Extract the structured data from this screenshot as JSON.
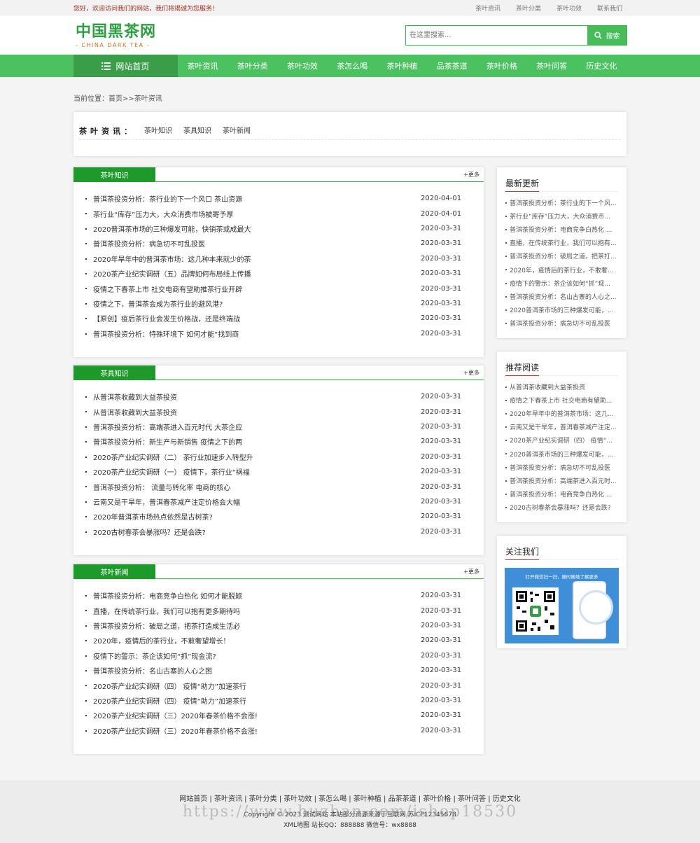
{
  "topbar": {
    "welcome": "您好，欢迎访问我们的网站，我们将竭诚为您服务！",
    "links": [
      "茶叶资讯",
      "茶叶分类",
      "茶叶功效",
      "联系我们"
    ]
  },
  "logo": {
    "cn": "中国黑茶网",
    "en": "- CHINA DARK TEA -"
  },
  "search": {
    "placeholder": "在这里搜索...",
    "button": "搜索"
  },
  "nav": {
    "home": "网站首页",
    "items": [
      "茶叶资讯",
      "茶叶分类",
      "茶叶功效",
      "茶怎么喝",
      "茶叶种植",
      "品茶茶道",
      "茶叶价格",
      "茶叶问答",
      "历史文化"
    ]
  },
  "breadcrumb": "当前位置：首页>>茶叶资讯",
  "category": {
    "title": "茶叶资讯：",
    "links": [
      "茶叶知识",
      "茶具知识",
      "茶叶新闻"
    ]
  },
  "more_label": "+更多",
  "panels": [
    {
      "tab": "茶叶知识",
      "items": [
        {
          "t": "普洱茶投资分析：茶行业的下一个风口 茶山资源",
          "d": "2020-04-01"
        },
        {
          "t": "茶行业“库存”压力大，大众消费市场被寄予厚",
          "d": "2020-04-01"
        },
        {
          "t": "2020普洱茶市场的三种爆发可能，快销茶或成最大",
          "d": "2020-03-31"
        },
        {
          "t": "普洱茶投资分析：病急切不可乱投医",
          "d": "2020-03-31"
        },
        {
          "t": "2020年旱年中的普洱茶市场：这几种本来就少的茶",
          "d": "2020-03-31"
        },
        {
          "t": "2020茶产业纪实调研（五）品牌如何布局线上传播",
          "d": "2020-03-31"
        },
        {
          "t": "疫情之下春茶上市 社交电商有望助推茶行业开辟",
          "d": "2020-03-31"
        },
        {
          "t": "疫情之下，普洱茶会成为茶行业的避风港?",
          "d": "2020-03-31"
        },
        {
          "t": "【原创】疫后茶行业会发生价格战，还是终端战",
          "d": "2020-03-31"
        },
        {
          "t": "普洱茶投资分析：特殊环境下 如何才能“找到商",
          "d": "2020-03-31"
        }
      ]
    },
    {
      "tab": "茶具知识",
      "items": [
        {
          "t": "从普洱茶收藏到大益茶投资",
          "d": "2020-03-31"
        },
        {
          "t": "从普洱茶收藏到大益茶投资",
          "d": "2020-03-31"
        },
        {
          "t": "普洱茶投资分析：高端茶进入百元时代 大茶企应",
          "d": "2020-03-31"
        },
        {
          "t": "普洱茶投资分析：新生产与新销售 疫情之下的两",
          "d": "2020-03-31"
        },
        {
          "t": "2020茶产业纪实调研（二） 茶行业加速步入转型升",
          "d": "2020-03-31"
        },
        {
          "t": "2020茶产业纪实调研（一） 疫情下，茶行业“祸福",
          "d": "2020-03-31"
        },
        {
          "t": "普洱茶投资分析： 流量与转化率 电商的核心",
          "d": "2020-03-31"
        },
        {
          "t": "云南又是干旱年，普洱春茶减产注定价格会大幅",
          "d": "2020-03-31"
        },
        {
          "t": "2020年普洱茶市场热点依然是古树茶?",
          "d": "2020-03-31"
        },
        {
          "t": "2020古树春茶会暴涨吗？还是会跌?",
          "d": "2020-03-31"
        }
      ]
    },
    {
      "tab": "茶叶新闻",
      "items": [
        {
          "t": "普洱茶投资分析：电商竞争白热化 如何才能脱颖",
          "d": "2020-03-31"
        },
        {
          "t": "直播，在传统茶行业，我们可以抱有更多期待吗",
          "d": "2020-03-31"
        },
        {
          "t": "普洱茶投资分析：破局之道，把茶打造成生活必",
          "d": "2020-03-31"
        },
        {
          "t": "2020年，疫情后的茶行业，不敢奢望增长！",
          "d": "2020-03-31"
        },
        {
          "t": "疫情下的警示：茶企该如何“抓”现金流?",
          "d": "2020-03-31"
        },
        {
          "t": "普洱茶投资分析：名山古寨的人心之困",
          "d": "2020-03-31"
        },
        {
          "t": "2020茶产业纪实调研（四） 疫情“助力”加速茶行",
          "d": "2020-03-31"
        },
        {
          "t": "2020茶产业纪实调研（四） 疫情“助力”加速茶行",
          "d": "2020-03-31"
        },
        {
          "t": "2020茶产业纪实调研（三）2020年春茶价格不会涨!",
          "d": "2020-03-31"
        },
        {
          "t": "2020茶产业纪实调研（三）2020年春茶价格不会涨!",
          "d": "2020-03-31"
        }
      ]
    }
  ],
  "sidebar": {
    "latest": {
      "title": "最新更新",
      "items": [
        "普洱茶投资分析：茶行业的下一个风...",
        "茶行业“库存”压力大，大众消费市...",
        "普洱茶投资分析：电商竞争白热化 ...",
        "直播，在传统茶行业，我们可以抱有...",
        "普洱茶投资分析：破局之道，把茶打...",
        "2020年，疫情后的茶行业，不敢奢...",
        "疫情下的警示：茶企该如何“抓”现...",
        "普洱茶投资分析：名山古寨的人心之...",
        "2020普洱茶市场的三种爆发可能，...",
        "普洱茶投资分析：病急切不可乱投医"
      ]
    },
    "recommend": {
      "title": "推荐阅读",
      "items": [
        "从普洱茶收藏到大益茶投资",
        "疫情之下春茶上市 社交电商有望助...",
        "2020年旱年中的普洱茶市场：这几...",
        "云南又是干旱年，普洱春茶减产注定...",
        "2020茶产业纪实调研（四） 疫情“...",
        "2020普洱茶市场的三种爆发可能，...",
        "普洱茶投资分析：病急切不可乱投医",
        "普洱茶投资分析：高端茶进入百元时...",
        "普洱茶投资分析：电商竞争白热化 ...",
        "2020古树春茶会暴涨吗？还是会跌?"
      ]
    },
    "follow": {
      "title": "关注我们",
      "qr_text": "打开微信扫一扫，随时随地了解更多"
    }
  },
  "footer": {
    "links": "网站首页 | 茶叶资讯 | 茶叶分类 | 茶叶功效 | 茶怎么喝 | 茶叶种植 | 品茶茶道 | 茶叶价格 | 茶叶问答 | 历史文化",
    "copyright": "Copyright © 2023 测试网站 本站部分资源来源于互联网 苏ICP12345678",
    "misc": "XML地图 站长QQ：888888 微信号：wx8888",
    "watermark": "https://www.huzhan.com/ishop18530"
  }
}
